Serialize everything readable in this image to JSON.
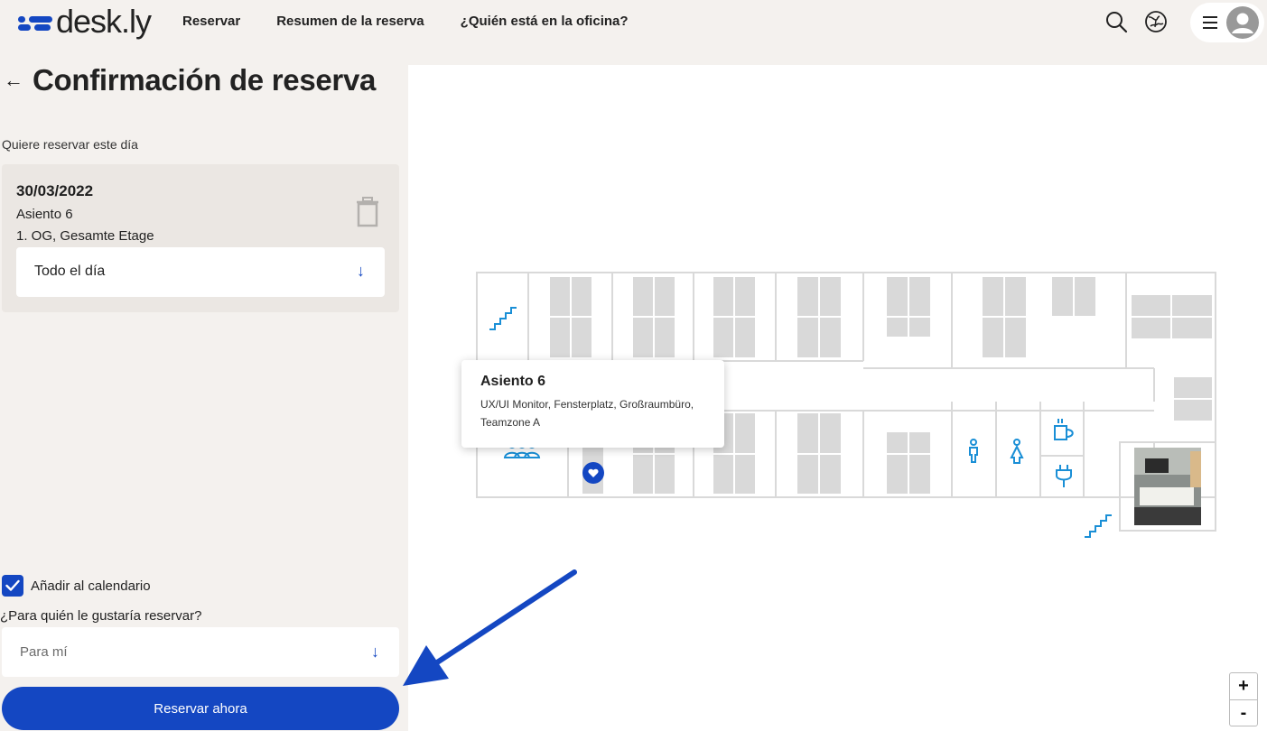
{
  "brand": {
    "name": "desk.ly",
    "color": "#1447c2"
  },
  "nav": [
    {
      "label": "Reservar"
    },
    {
      "label": "Resumen de la reserva"
    },
    {
      "label": "¿Quién está en la oficina?"
    }
  ],
  "header_icons": [
    "search-icon",
    "globe-icon",
    "hamburger-menu-icon",
    "user-avatar-icon"
  ],
  "page": {
    "back_icon": "←",
    "title": "Confirmación de reserva",
    "intro": "Quiere reservar este día"
  },
  "booking": {
    "date": "30/03/2022",
    "seat": "Asiento 6",
    "floor": "1. OG, Gesamte Etage",
    "duration": "Todo el día",
    "duration_chevron": "↓"
  },
  "options": {
    "add_to_calendar_label": "Añadir al calendario",
    "add_to_calendar_checked": true,
    "for_whom_label": "¿Para quién le gustaría reservar?",
    "for_whom_value": "Para mí",
    "for_whom_chevron": "↓",
    "submit_label": "Reservar ahora"
  },
  "map": {
    "tooltip_title": "Asiento 6",
    "tooltip_desc": "UX/UI Monitor, Fensterplatz, Großraumbüro, Teamzone A",
    "zoom_in": "+",
    "zoom_out": "-",
    "accent_icon_color": "#1a8fd6"
  }
}
